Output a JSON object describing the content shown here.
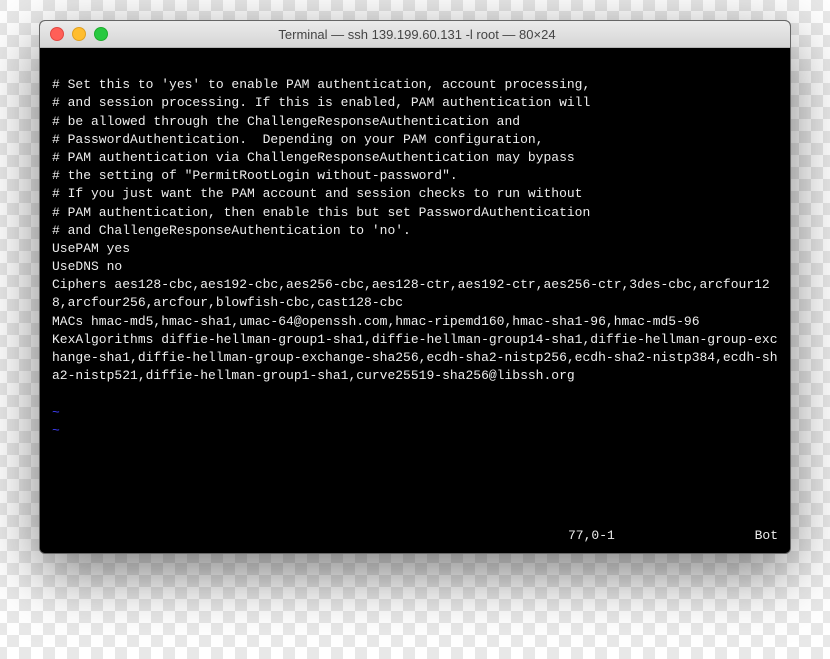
{
  "window": {
    "title": "Terminal — ssh 139.199.60.131 -l root — 80×24"
  },
  "terminal": {
    "lines": [
      "",
      "# Set this to 'yes' to enable PAM authentication, account processing,",
      "# and session processing. If this is enabled, PAM authentication will",
      "# be allowed through the ChallengeResponseAuthentication and",
      "# PasswordAuthentication.  Depending on your PAM configuration,",
      "# PAM authentication via ChallengeResponseAuthentication may bypass",
      "# the setting of \"PermitRootLogin without-password\".",
      "# If you just want the PAM account and session checks to run without",
      "# PAM authentication, then enable this but set PasswordAuthentication",
      "# and ChallengeResponseAuthentication to 'no'.",
      "UsePAM yes",
      "UseDNS no",
      "Ciphers aes128-cbc,aes192-cbc,aes256-cbc,aes128-ctr,aes192-ctr,aes256-ctr,3des-cbc,arcfour128,arcfour256,arcfour,blowfish-cbc,cast128-cbc",
      "MACs hmac-md5,hmac-sha1,umac-64@openssh.com,hmac-ripemd160,hmac-sha1-96,hmac-md5-96",
      "KexAlgorithms diffie-hellman-group1-sha1,diffie-hellman-group14-sha1,diffie-hellman-group-exchange-sha1,diffie-hellman-group-exchange-sha256,ecdh-sha2-nistp256,ecdh-sha2-nistp384,ecdh-sha2-nistp521,diffie-hellman-group1-sha1,curve25519-sha256@libssh.org",
      ""
    ],
    "tildes": [
      "~",
      "~"
    ]
  },
  "vim_status": {
    "position": "77,0-1",
    "scroll": "Bot"
  }
}
